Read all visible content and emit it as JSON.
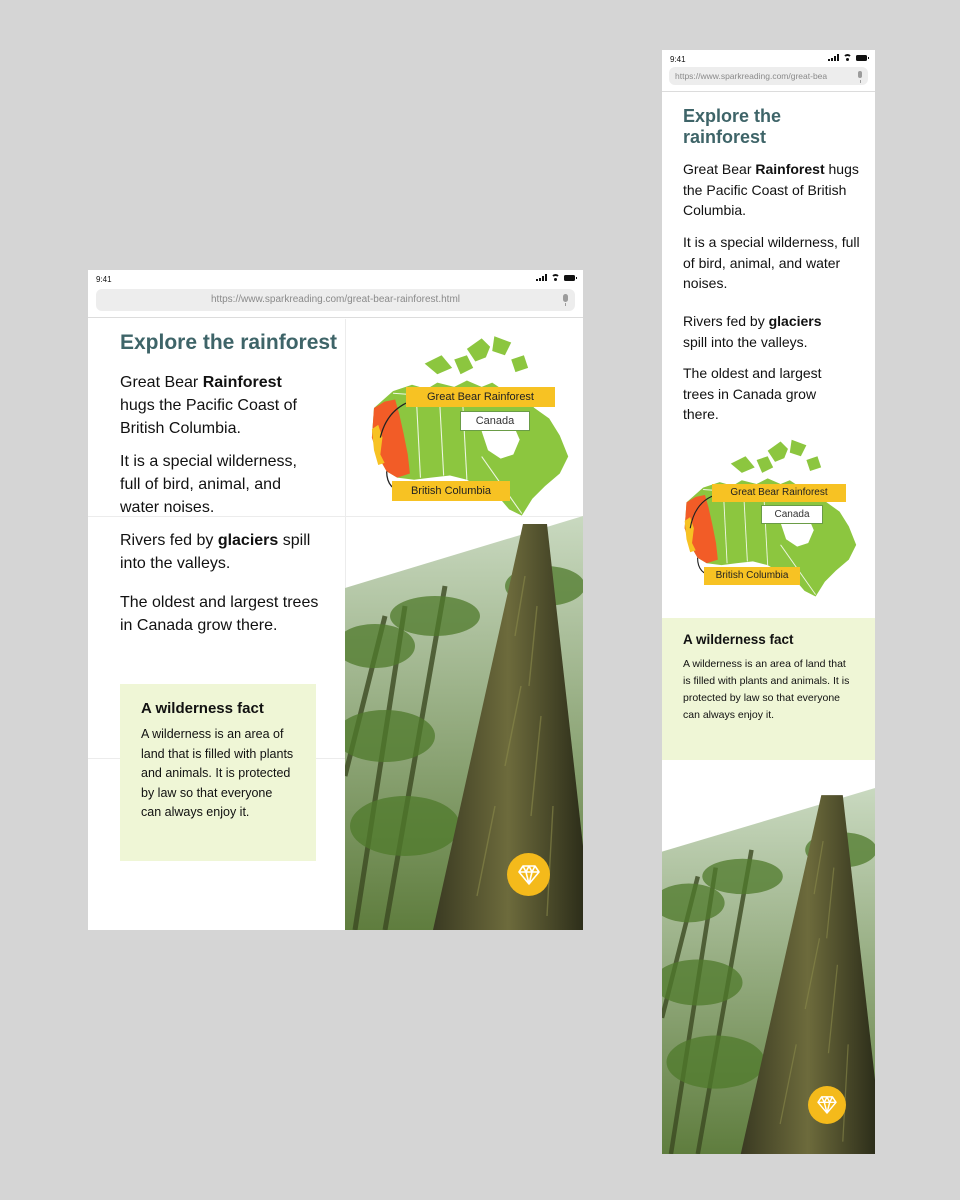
{
  "status_bar": {
    "time": "9:41"
  },
  "tablet": {
    "url": "https://www.sparkreading.com/great-bear-rainforest.html"
  },
  "phone": {
    "url": "https://www.sparkreading.com/great-bea"
  },
  "article": {
    "title": "Explore the rainforest",
    "p1": {
      "before": "Great Bear ",
      "bold": "Rainforest",
      "after": " hugs the Pacific Coast of British Columbia."
    },
    "p2": "It is a special wilderness, full of bird, animal, and water noises.",
    "p3": {
      "before": "Rivers fed by ",
      "bold": "glaciers",
      "after": " spill into the valleys."
    },
    "p4": "The oldest and largest trees in Canada grow there."
  },
  "map": {
    "labels": {
      "rainforest": "Great Bear Rainforest",
      "country": "Canada",
      "province": "British Columbia"
    },
    "colors": {
      "land": "#8cc63f",
      "province": "#f25c27",
      "rainforest": "#f7c223",
      "water": "#ffffff"
    }
  },
  "fact": {
    "title": "A wilderness fact",
    "text": "A wilderness is an area of land that is filled with plants and animals. It is protected by law so that everyone can always enjoy it."
  },
  "icons": {
    "gem_button": "gem-icon"
  }
}
